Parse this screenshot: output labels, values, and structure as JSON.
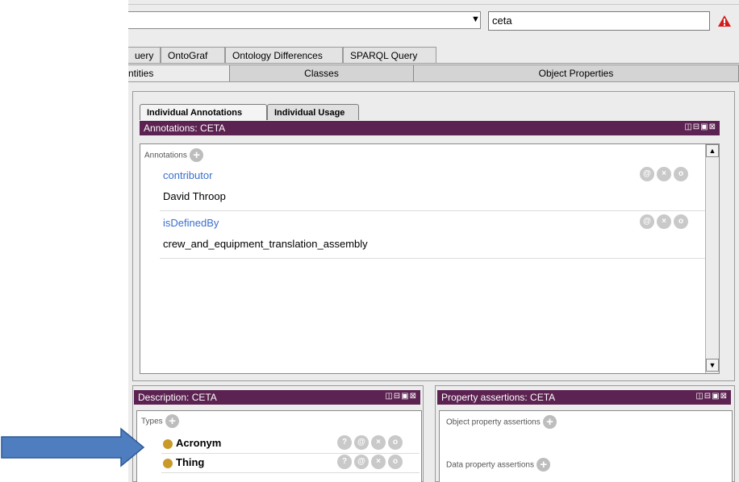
{
  "search": {
    "value": "ceta"
  },
  "main_tabs": [
    "uery",
    "OntoGraf",
    "Ontology Differences",
    "SPARQL Query"
  ],
  "sub_tabs": [
    "ntities",
    "Classes",
    "Object Properties"
  ],
  "annotations_panel": {
    "tabs": [
      "Individual Annotations",
      "Individual Usage"
    ],
    "title": "Annotations: CETA",
    "section_label": "Annotations",
    "items": [
      {
        "property": "contributor",
        "value": "David Throop"
      },
      {
        "property": "isDefinedBy",
        "value": "crew_and_equipment_translation_assembly"
      }
    ]
  },
  "description_panel": {
    "title": "Description: CETA",
    "section_label": "Types",
    "types": [
      "Acronym",
      "Thing"
    ]
  },
  "property_panel": {
    "title": "Property assertions: CETA",
    "object_label": "Object property assertions",
    "data_label": "Data property assertions"
  },
  "icons": {
    "annotation": "@",
    "delete": "×",
    "edit": "o",
    "explain": "?",
    "plus": "+",
    "view_controls": "◫⊟▣⊠"
  },
  "colors": {
    "title_bar": "#5c2352",
    "link": "#3a6fcf",
    "entity_dot": "#c99a2a",
    "arrow": "#4f7ec0"
  }
}
